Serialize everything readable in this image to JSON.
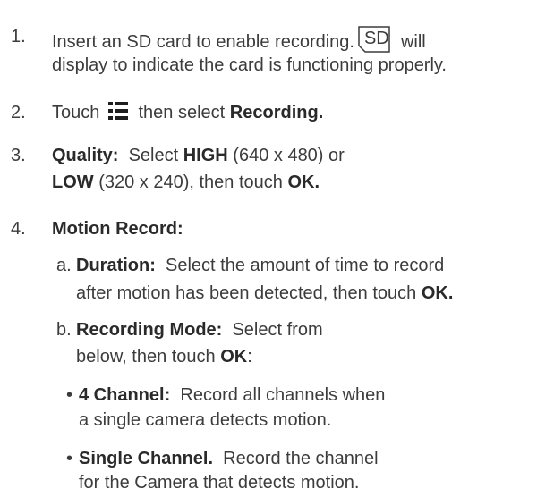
{
  "steps": {
    "s1": {
      "num": "1.",
      "line1_pre": "Insert an SD card to enable recording.",
      "sd_label": "SD",
      "line1_post": "will",
      "line2": "display to indicate the card is functioning properly."
    },
    "s2": {
      "num": "2.",
      "pre": "Touch",
      "mid": "then select",
      "bold": "Recording."
    },
    "s3": {
      "num": "3.",
      "b1": "Quality:",
      "t1": "Select",
      "b2": "HIGH",
      "t2": "(640 x 480) or",
      "b3": "LOW",
      "t3": "(320 x 240), then touch",
      "b4": "OK."
    },
    "s4": {
      "num": "4.",
      "title": "Motion Record:",
      "a": {
        "letter": "a.",
        "bold": "Duration:",
        "line1": "Select the amount of time to record",
        "line2": "after motion has been detected, then touch",
        "line2_bold": "OK."
      },
      "b": {
        "letter": "b.",
        "bold": "Recording Mode:",
        "line1": "Select from",
        "line2": "below, then touch",
        "line2_bold": "OK",
        "line2_end": ":",
        "bullets": [
          {
            "symbol": "•",
            "bold": "4 Channel:",
            "line1": "Record all channels when",
            "line2": "a single camera detects motion."
          },
          {
            "symbol": "•",
            "bold": "Single Channel.",
            "line1": "Record the channel",
            "line2": "for the Camera that detects motion."
          }
        ]
      }
    }
  }
}
